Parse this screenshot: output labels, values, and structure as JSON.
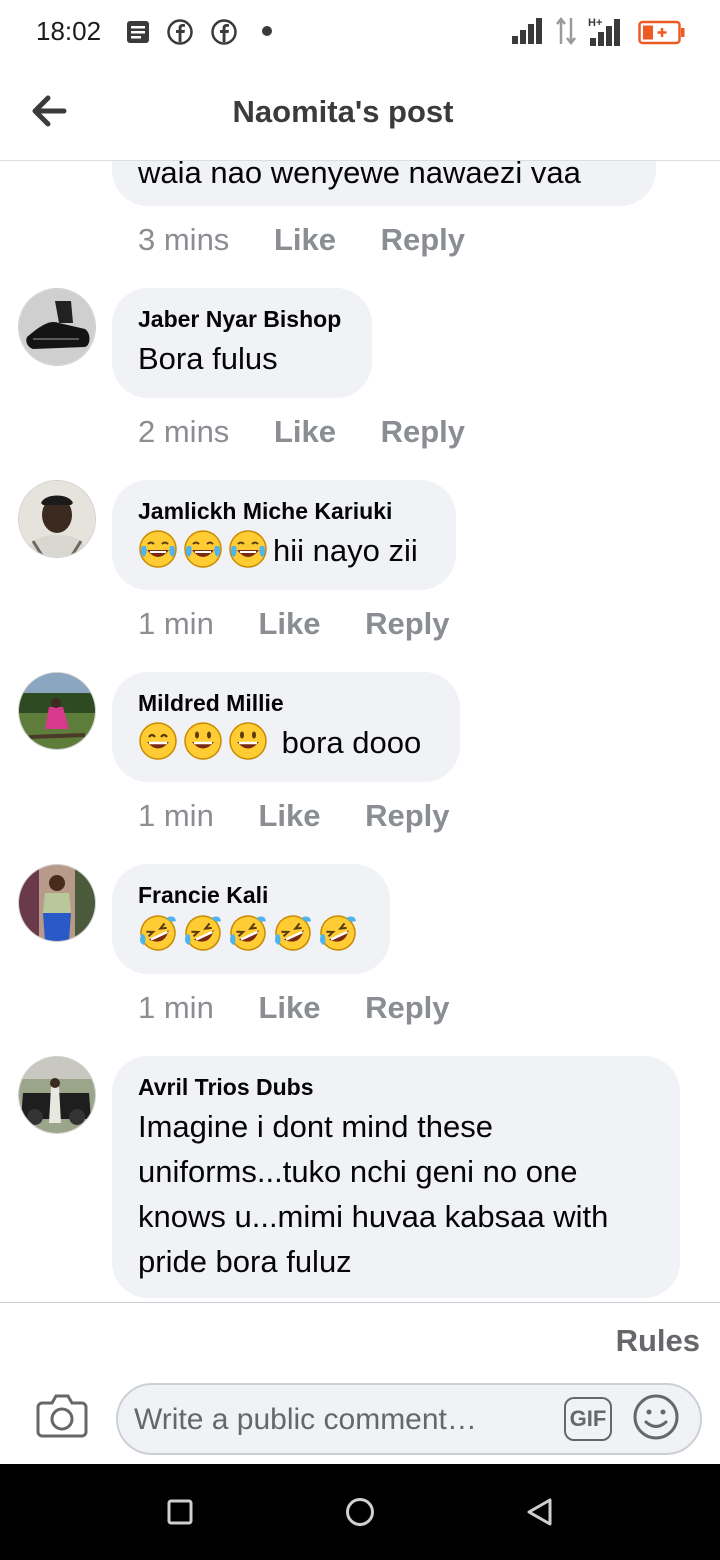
{
  "status_bar": {
    "time": "18:02",
    "icons": [
      "notification-icon",
      "facebook-icon",
      "facebook-icon",
      "dot-icon",
      "signal-icon",
      "data-transfer-icon",
      "hplus-signal-icon",
      "battery-icon"
    ]
  },
  "header": {
    "title": "Naomita's post",
    "back_icon": "back-arrow-icon"
  },
  "partial_comment": {
    "text": "waia nao wenyewe nawaezi vaa",
    "time": "3 mins",
    "like": "Like",
    "reply": "Reply"
  },
  "comments": [
    {
      "author": "Jaber Nyar Bishop",
      "text": "Bora fulus",
      "emojis": [],
      "time": "2 mins",
      "like": "Like",
      "reply": "Reply"
    },
    {
      "author": "Jamlickh Miche Kariuki",
      "text": "hii nayo zii",
      "emojis": [
        "tears-of-joy",
        "tears-of-joy",
        "tears-of-joy"
      ],
      "time": "1 min",
      "like": "Like",
      "reply": "Reply"
    },
    {
      "author": "Mildred Millie",
      "text": " bora dooo",
      "emojis": [
        "grinning-smiling-eyes",
        "grinning",
        "grinning"
      ],
      "time": "1 min",
      "like": "Like",
      "reply": "Reply"
    },
    {
      "author": "Francie Kali",
      "text": "",
      "emojis": [
        "rolling-laughing",
        "rolling-laughing",
        "rolling-laughing",
        "rolling-laughing",
        "rolling-laughing"
      ],
      "time": "1 min",
      "like": "Like",
      "reply": "Reply"
    },
    {
      "author": "Avril Trios Dubs",
      "text": "Imagine i dont mind these uniforms...tuko nchi geni no one knows u...mimi huvaa kabsaa with pride bora fuluz",
      "emojis": [],
      "time": "",
      "like": "",
      "reply": ""
    }
  ],
  "footer": {
    "rules": "Rules",
    "placeholder": "Write a public comment…",
    "gif": "GIF",
    "camera_icon": "camera-icon",
    "emoji_icon": "smiley-icon"
  },
  "nav": {
    "icons": [
      "recents-square-icon",
      "home-circle-icon",
      "back-triangle-icon"
    ]
  },
  "colors": {
    "bubble": "#f0f2f5",
    "meta": "#8a8d91",
    "title": "#3a3b3c"
  }
}
